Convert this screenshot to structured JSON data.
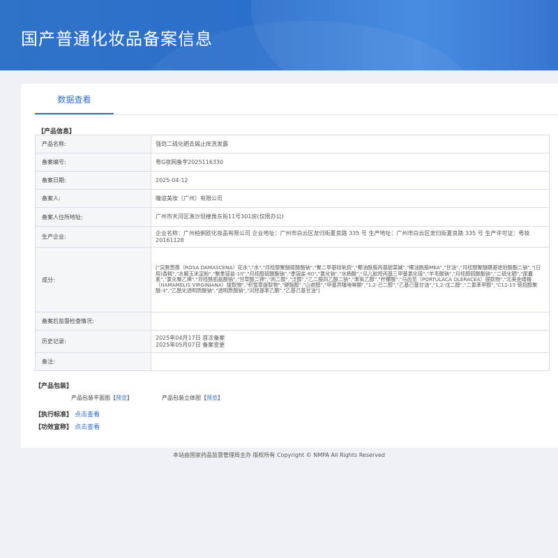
{
  "header": {
    "title": "国产普通化妆品备案信息"
  },
  "tabs": [
    {
      "label": "数据查看"
    }
  ],
  "product_section": {
    "title": "【产品信息】"
  },
  "rows": [
    {
      "label": "产品名称:",
      "value": "强劲二硫化硒去屑止痒洗发露"
    },
    {
      "label": "备案编号:",
      "value": "粤G妆网备字2025116330"
    },
    {
      "label": "备案日期:",
      "value": "2025-04-12"
    },
    {
      "label": "备案人:",
      "value": "瞳谊美妆（广州）有限公司"
    },
    {
      "label": "备案人住所地址:",
      "value": "广州市天河区渔沙坦楼角东街11号301房(仅限办公)"
    },
    {
      "label": "生产企业:",
      "value": "企业名称：广州柏俐欧化妆品有限公司 企业地址：广州市白云区龙归街夏良路 335 号 生产地址：广州市白云区龙归街夏良路 335 号 生产许可证：粤妆20161128"
    },
    {
      "label": "成分:",
      "value": "[\"突厥蔷薇（ROSA DAMASCENA）花水\",\"水\",\"月桂醇聚醚硫酸酯钠\",\"聚二甲基硅氧烷\",\"椰油酰胺丙基甜菜碱\",\"椰油酰胺MEA\",\"甘油\",\"月桂醇聚醚磺基琥珀酸酯二钠\",\"(日用)香精\",\"水解玉米淀粉\",\"聚季铵盐-10\",\"月桂醇硫酸酯钠\",\"季铵盐-80\",\"氯化钠\",\"水杨酸\",\"瓜儿胶羟丙基三甲基氯化铵\",\"羊毛酸钠\",\"月桂醇硫酸酯钠\",\"二硫化硒\",\"尿囊素\",\"氯化聚乙烯\",\"月桂酰肌氨酸钠\",\"甘草酸二钾\",\"丙二醇\",\"泛醇\",\"乙二胺四乙酸二钠\",\"苯氧乙醇\",\"柠檬酸\",\"马齿苋（PORTULACA OLERACEA）提取物\",\"北美金缕梅（HAMAMELIS VIRGINIANA）提取物\",\"积雪草提取物\",\"硬脂醇\",\"山嵛醇\",\"甲基异噻唑啉酮\",\"1,2-己二醇\",\"乙基己基甘油\",\"1,2-戊二醇\",\"二氯苯甲醇\",\"C12-15 链烷醇聚醚-3\",\"乙酰化透明质酸钠\",\"透明质酸钠\",\"对羟基苯乙酮\",\"乙基己基甘油\"]"
    },
    {
      "label": "备案后监督检查情况:",
      "value": ""
    },
    {
      "label": "历史记录:",
      "value": "2025年04月17日 首次备案",
      "value2": "2025年05月07日 备案变更"
    },
    {
      "label": "备注:",
      "value": ""
    }
  ],
  "packaging": {
    "title": "【产品包装】",
    "flat_label": "产品包装平面图",
    "solid_label": "产品包装立体图",
    "preview_text": "预览",
    "bracket_open": "【",
    "bracket_close": "】"
  },
  "standard": {
    "title": "【执行标准】",
    "link": "点击查看"
  },
  "efficacy": {
    "title": "【功效宣称】",
    "link": "点击查看"
  },
  "footer": {
    "text": "本站由国家药品监督管理局主办 版权所有 Copyright © NMPA All Rights Reserved"
  }
}
